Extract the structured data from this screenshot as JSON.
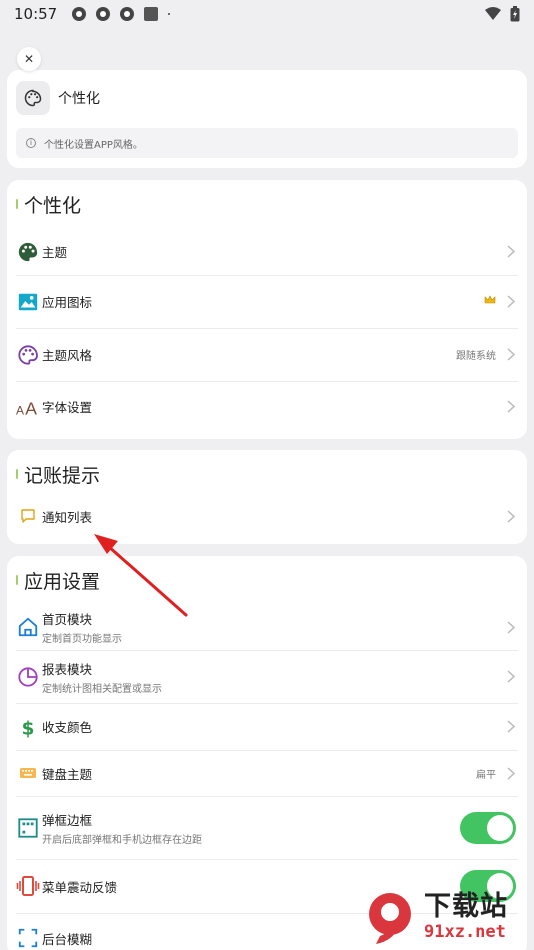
{
  "status_bar": {
    "time": "10:57"
  },
  "header": {
    "title": "个性化",
    "hint": "个性化设置APP风格。"
  },
  "sections": {
    "personalize": {
      "title": "个性化",
      "items": [
        {
          "label": "主题",
          "icon": "palette-icon"
        },
        {
          "label": "应用图标",
          "icon": "image-icon",
          "badge": "crown-icon"
        },
        {
          "label": "主题风格",
          "icon": "palette-outline-icon",
          "value": "跟随系统"
        },
        {
          "label": "字体设置",
          "icon": "font-size-icon"
        }
      ]
    },
    "accounting_reminder": {
      "title": "记账提示",
      "items": [
        {
          "label": "通知列表",
          "icon": "message-icon"
        }
      ]
    },
    "app_settings": {
      "title": "应用设置",
      "items": [
        {
          "label": "首页模块",
          "sub": "定制首页功能显示",
          "icon": "home-icon"
        },
        {
          "label": "报表模块",
          "sub": "定制统计图相关配置或显示",
          "icon": "pie-chart-icon"
        },
        {
          "label": "收支颜色",
          "icon": "dollar-icon"
        },
        {
          "label": "键盘主题",
          "icon": "keyboard-icon",
          "value": "扁平"
        },
        {
          "label": "弹框边框",
          "sub": "开启后底部弹框和手机边框存在边距",
          "icon": "frame-icon",
          "toggle": true
        },
        {
          "label": "菜单震动反馈",
          "icon": "vibration-icon",
          "toggle": true
        },
        {
          "label": "后台模糊",
          "icon": "blur-icon"
        }
      ]
    }
  },
  "watermark": {
    "title": "下载站",
    "url": "91xz.net",
    "logo": "9"
  },
  "colors": {
    "toggle_on": "#43c463",
    "accent_arrow": "#e02020",
    "section_bar": "#8bc34a"
  }
}
